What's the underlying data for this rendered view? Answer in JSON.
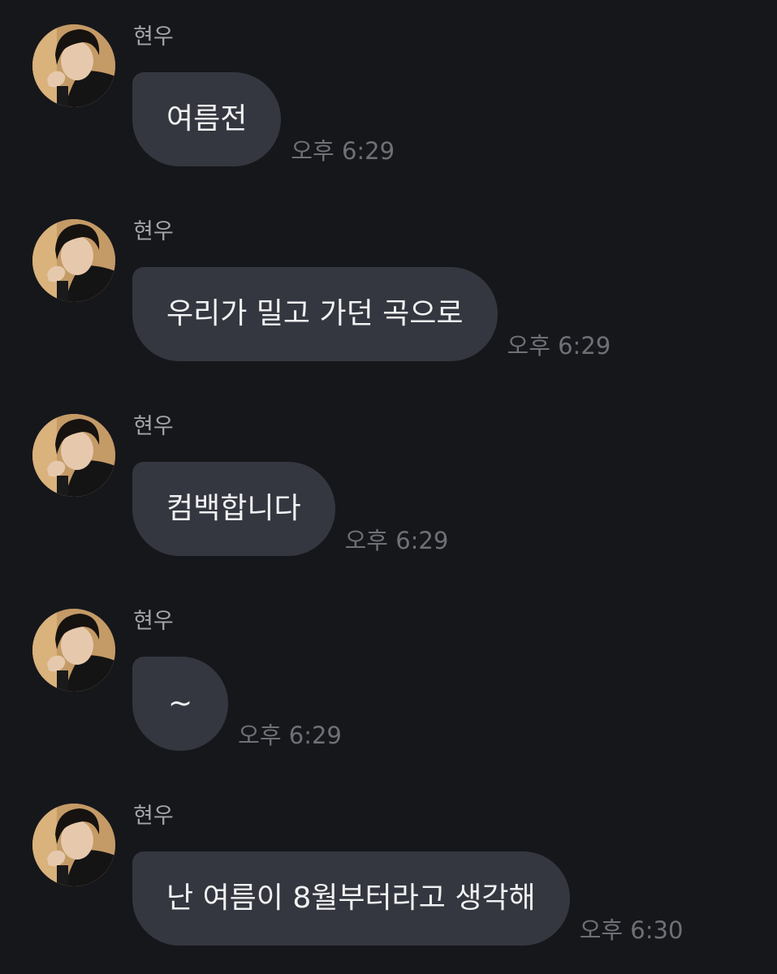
{
  "messages": [
    {
      "sender": "현우",
      "text": "여름전",
      "time": "오후 6:29"
    },
    {
      "sender": "현우",
      "text": "우리가 밀고 가던 곡으로",
      "time": "오후 6:29"
    },
    {
      "sender": "현우",
      "text": "컴백합니다",
      "time": "오후 6:29"
    },
    {
      "sender": "현우",
      "text": "~",
      "time": "오후 6:29"
    },
    {
      "sender": "현우",
      "text": "난 여름이 8월부터라고 생각해",
      "time": "오후 6:30"
    }
  ],
  "colors": {
    "background": "#16171b",
    "bubble": "#34373f",
    "bubble_text": "#f1f1f3",
    "sender_text": "#a4a5aa",
    "time_text": "#6e7077"
  },
  "icons": {
    "avatar": "profile-photo-avatar"
  }
}
